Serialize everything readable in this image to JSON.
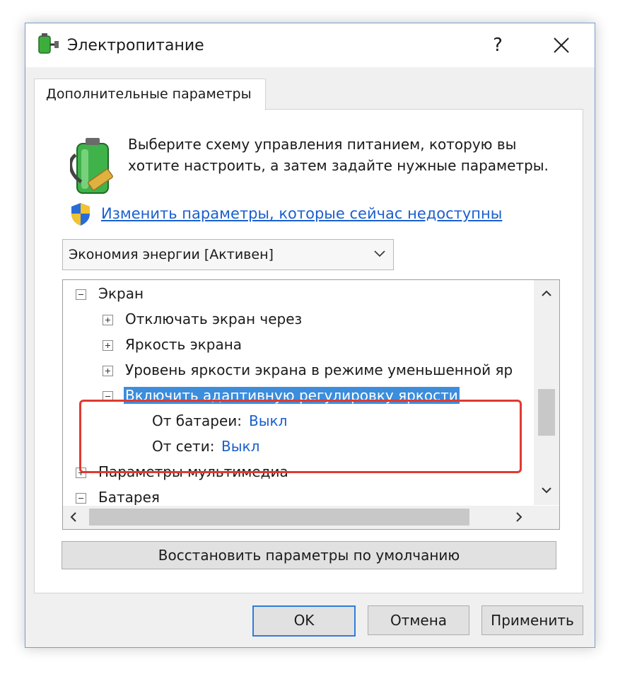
{
  "window": {
    "title": "Электропитание",
    "help_label": "?",
    "icon": "power-plug-icon"
  },
  "tab": {
    "label": "Дополнительные параметры"
  },
  "intro": {
    "text": "Выберите схему управления питанием, которую вы хотите настроить, а затем задайте нужные параметры."
  },
  "change_link": {
    "label": "Изменить параметры, которые сейчас недоступны"
  },
  "plan_select": {
    "value": "Экономия энергии [Активен]"
  },
  "tree": {
    "screen": "Экран",
    "screen_off": "Отключать экран через",
    "brightness": "Яркость экрана",
    "dim_brightness": "Уровень яркости экрана в режиме уменьшенной яр",
    "adaptive": "Включить адаптивную регулировку яркости",
    "battery_label": "От батареи:",
    "battery_value": "Выкл",
    "ac_label": "От сети:",
    "ac_value": "Выкл",
    "multimedia": "Параметры мультимедиа",
    "battery": "Батарея"
  },
  "buttons": {
    "restore": "Восстановить параметры по умолчанию",
    "ok": "OK",
    "cancel": "Отмена",
    "apply": "Применить"
  },
  "colors": {
    "accent": "#3c8ddc",
    "link": "#1a5fcf",
    "annotation": "#e03a31"
  }
}
